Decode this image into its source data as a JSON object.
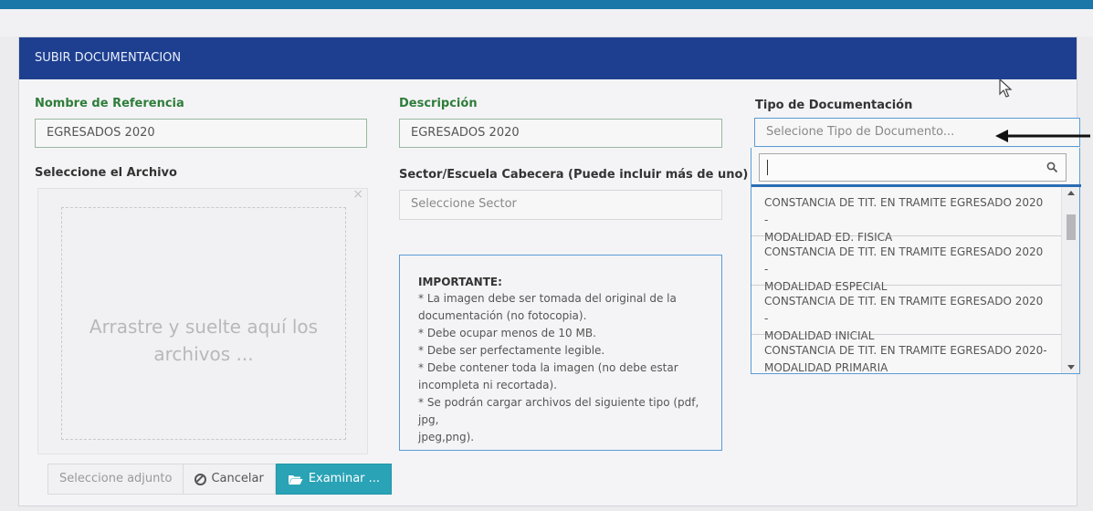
{
  "header": {
    "title": "SUBIR DOCUMENTACION"
  },
  "reference": {
    "label": "Nombre de Referencia",
    "value": "EGRESADOS 2020"
  },
  "description": {
    "label": "Descripción",
    "value": "EGRESADOS 2020"
  },
  "doc_type": {
    "label": "Tipo de Documentación",
    "placeholder": "Selecione Tipo de Documento..."
  },
  "file": {
    "label": "Seleccione el Archivo",
    "dropzone_text": "Arrastre y suelte aquí los archivos ...",
    "close_glyph": "×",
    "selected_placeholder": "Seleccione adjunto",
    "cancel_label": "Cancelar",
    "browse_label": "Examinar ..."
  },
  "sector": {
    "label": "Sector/Escuela Cabecera (Puede incluir más de uno)",
    "placeholder": "Seleccione Sector"
  },
  "important": {
    "title": "IMPORTANTE:",
    "lines": [
      "* La imagen debe ser tomada del original de la",
      "documentación (no fotocopia).",
      "* Debe ocupar menos de 10 MB.",
      "* Debe ser perfectamente legible.",
      "* Debe contener toda la imagen (no debe estar",
      "incompleta ni recortada).",
      "* Se podrán cargar archivos del siguiente tipo (pdf, jpg,",
      "jpeg,png)."
    ]
  },
  "dropdown": {
    "search_value": "",
    "options": [
      {
        "line1": "CONSTANCIA DE TIT. EN TRAMITE EGRESADO 2020 -",
        "line2": "MODALIDAD ED. FISICA"
      },
      {
        "line1": "CONSTANCIA DE TIT. EN TRAMITE EGRESADO 2020 -",
        "line2": "MODALIDAD ESPECIAL"
      },
      {
        "line1": "CONSTANCIA DE TIT. EN TRAMITE EGRESADO 2020 -",
        "line2": "MODALIDAD INICIAL"
      },
      {
        "line1": "CONSTANCIA DE TIT. EN TRAMITE EGRESADO 2020-",
        "line2": "MODALIDAD PRIMARIA"
      }
    ]
  },
  "colors": {
    "header": "#1e3f8f",
    "label_green": "#2e7d3a",
    "browse_button": "#2aa3b6",
    "focus_border": "#5b9bd5"
  }
}
